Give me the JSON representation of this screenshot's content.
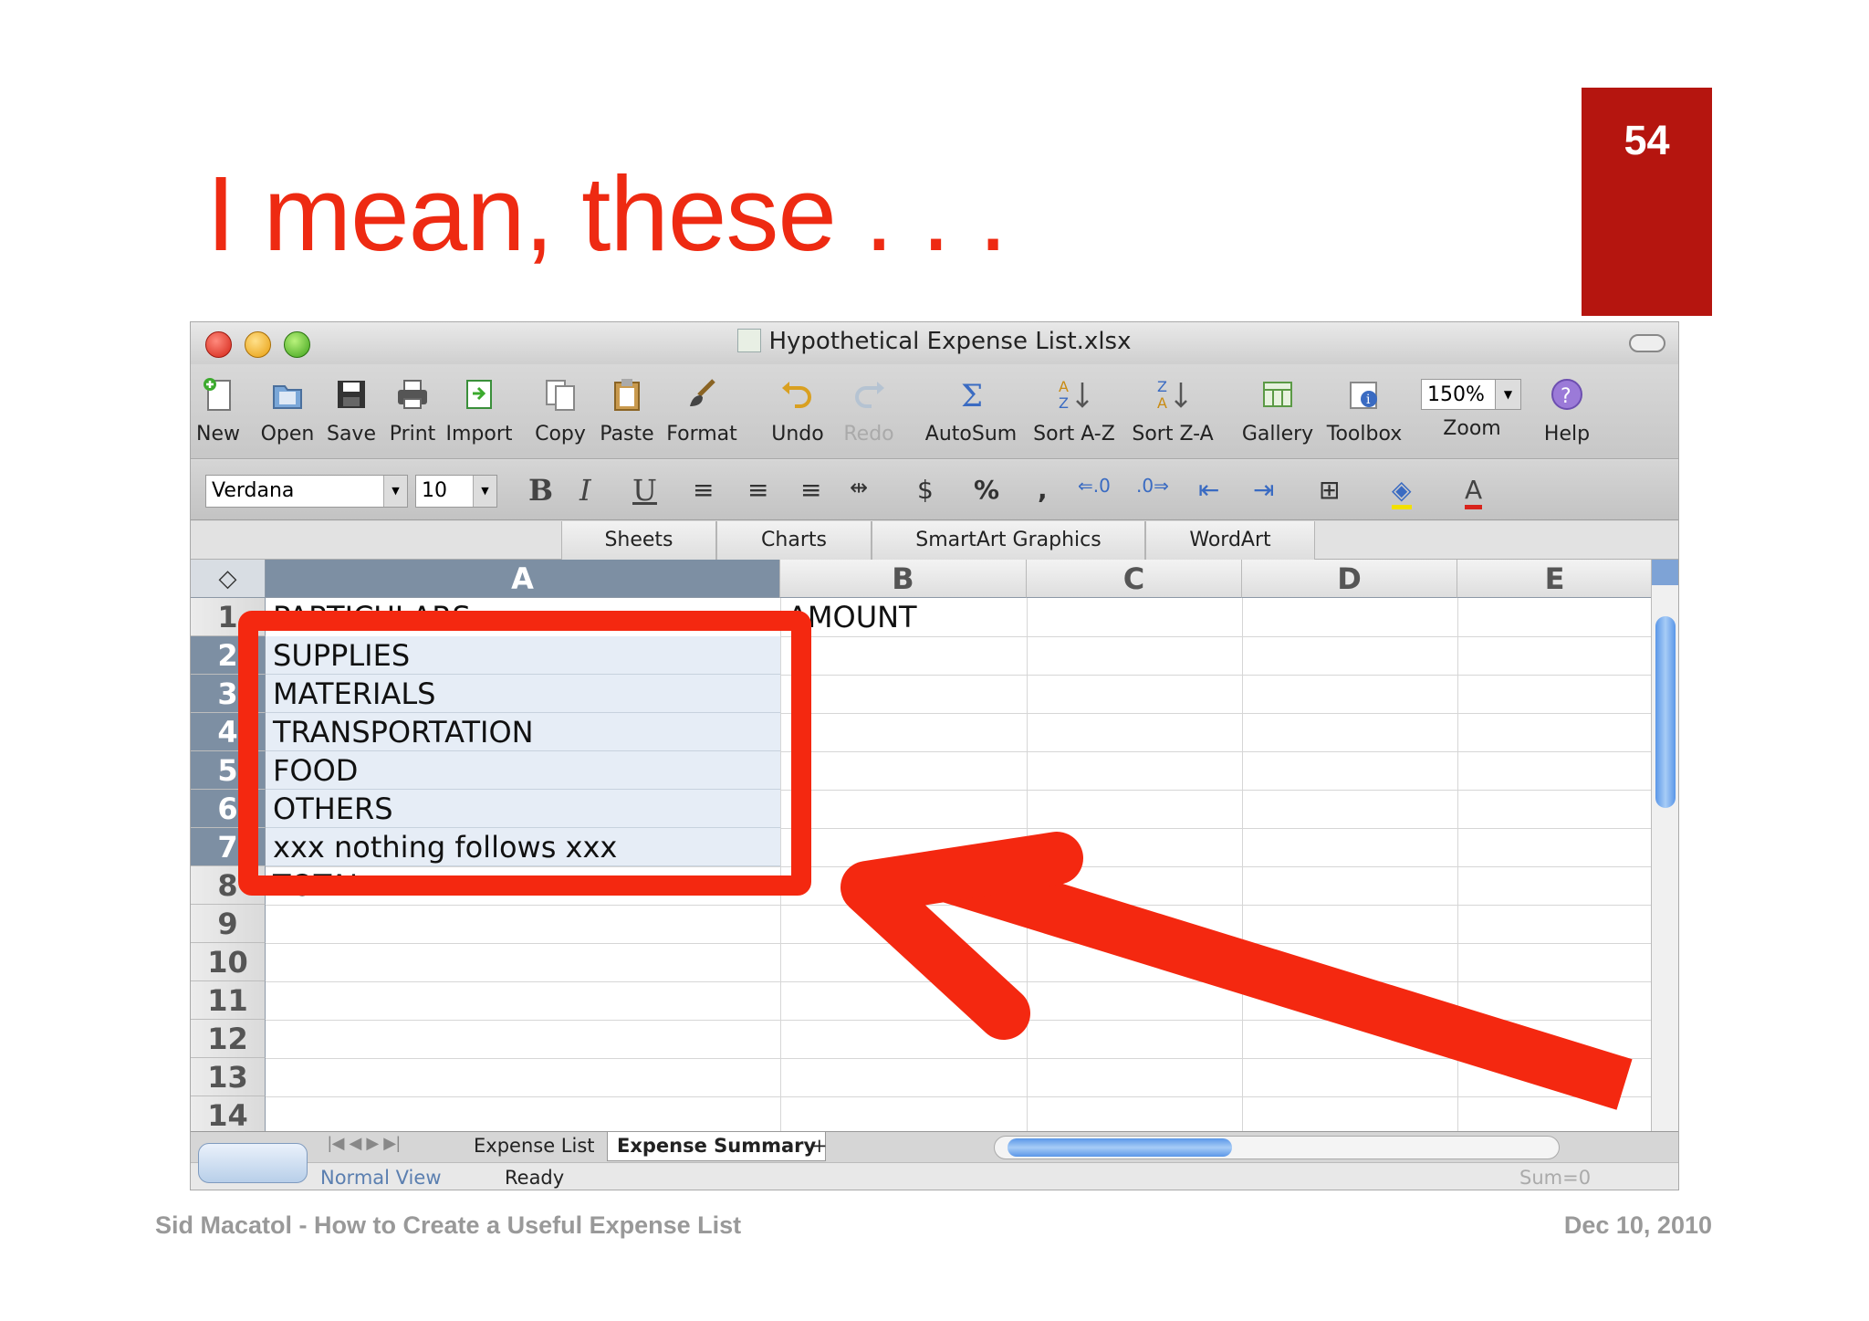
{
  "slide": {
    "title": "I mean, these . . .",
    "page_number": "54",
    "footer_left": "Sid Macatol - How to Create a Useful Expense List",
    "footer_right": "Dec 10, 2010",
    "accent_color": "#ee2a12",
    "page_box_color": "#b5150f"
  },
  "window": {
    "title": "Hypothetical Expense List.xlsx"
  },
  "toolbar": {
    "items": [
      {
        "label": "New",
        "icon": "new-document-icon"
      },
      {
        "label": "Open",
        "icon": "open-folder-icon"
      },
      {
        "label": "Save",
        "icon": "floppy-disk-icon"
      },
      {
        "label": "Print",
        "icon": "printer-icon"
      },
      {
        "label": "Import",
        "icon": "import-icon"
      },
      {
        "label": "Copy",
        "icon": "copy-icon"
      },
      {
        "label": "Paste",
        "icon": "clipboard-icon"
      },
      {
        "label": "Format",
        "icon": "paintbrush-icon"
      },
      {
        "label": "Undo",
        "icon": "undo-icon"
      },
      {
        "label": "Redo",
        "icon": "redo-icon"
      },
      {
        "label": "AutoSum",
        "icon": "sigma-icon"
      },
      {
        "label": "Sort A-Z",
        "icon": "sort-ascending-icon"
      },
      {
        "label": "Sort Z-A",
        "icon": "sort-descending-icon"
      },
      {
        "label": "Gallery",
        "icon": "gallery-icon"
      },
      {
        "label": "Toolbox",
        "icon": "toolbox-icon"
      },
      {
        "label": "Zoom",
        "icon": "zoom-icon"
      },
      {
        "label": "Help",
        "icon": "help-icon"
      }
    ],
    "zoom_value": "150%"
  },
  "format_bar": {
    "font": "Verdana",
    "size": "10"
  },
  "ribbon": {
    "tabs": [
      "Sheets",
      "Charts",
      "SmartArt Graphics",
      "WordArt"
    ]
  },
  "grid": {
    "columns": [
      "A",
      "B",
      "C",
      "D",
      "E"
    ],
    "rows": [
      "1",
      "2",
      "3",
      "4",
      "5",
      "6",
      "7",
      "8",
      "9",
      "10",
      "11",
      "12",
      "13",
      "14"
    ],
    "cells": {
      "a1": "PARTICULARS",
      "b1": "AMOUNT",
      "a2": "SUPPLIES",
      "a3": "MATERIALS",
      "a4": "TRANSPORTATION",
      "a5": "FOOD",
      "a6": "OTHERS",
      "a7": "xxx nothing follows xxx",
      "a8": "TOTAL"
    }
  },
  "sheets": {
    "tabs": [
      "Expense List",
      "Expense Summary"
    ],
    "add": "+"
  },
  "status": {
    "view": "Normal View",
    "state": "Ready",
    "sum": "Sum=0"
  }
}
